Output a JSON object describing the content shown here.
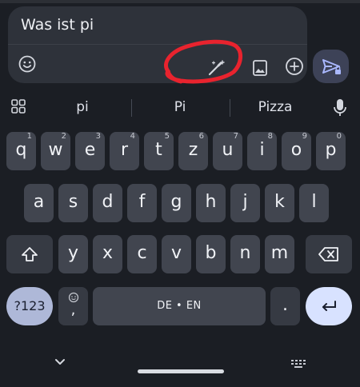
{
  "compose": {
    "text": "Was ist pi",
    "icons": [
      "emoji-icon",
      "magic-wand-icon",
      "image-attach-icon",
      "add-circle-icon",
      "send-icon"
    ]
  },
  "suggestions": [
    "pi",
    "Pi",
    "Pizza"
  ],
  "keyboard": {
    "row1": [
      {
        "k": "q",
        "h": "1"
      },
      {
        "k": "w",
        "h": "2"
      },
      {
        "k": "e",
        "h": "3"
      },
      {
        "k": "r",
        "h": "4"
      },
      {
        "k": "t",
        "h": "5"
      },
      {
        "k": "z",
        "h": "6"
      },
      {
        "k": "u",
        "h": "7"
      },
      {
        "k": "i",
        "h": "8"
      },
      {
        "k": "o",
        "h": "9"
      },
      {
        "k": "p",
        "h": "0"
      }
    ],
    "row2": [
      "a",
      "s",
      "d",
      "f",
      "g",
      "h",
      "j",
      "k",
      "l"
    ],
    "row3": [
      "y",
      "x",
      "c",
      "v",
      "b",
      "n",
      "m"
    ],
    "symbols_label": "?123",
    "comma": ",",
    "space_label": "DE • EN",
    "period": "."
  },
  "colors": {
    "background": "#1b1e24",
    "key": "#41454f",
    "modifier_key": "#363a43",
    "symbols_key": "#aeb8d8",
    "enter_key": "#d8e2ff",
    "annotation": "#e8232e"
  }
}
